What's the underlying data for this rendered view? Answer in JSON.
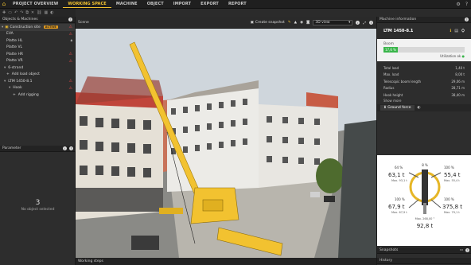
{
  "nav": {
    "items": [
      "PROJECT OVERVIEW",
      "WORKING SPACE",
      "MACHINE",
      "OBJECT",
      "IMPORT",
      "EXPORT",
      "REPORT"
    ],
    "active": "WORKING SPACE"
  },
  "left_panel": {
    "title": "Objects & Machines",
    "site": {
      "label": "Construction site",
      "badge": "ACTIVE"
    },
    "items": [
      {
        "label": "EVA",
        "flag": "warn"
      },
      {
        "label": "Platte HL",
        "flag": "lock"
      },
      {
        "label": "Platte VL",
        "flag": ""
      },
      {
        "label": "Platte HR",
        "flag": "warn"
      },
      {
        "label": "Platte VR",
        "flag": "warn"
      }
    ],
    "strand": "6-strand",
    "add_load": "Add load object",
    "machine": "LTM 1450-8.1",
    "hook": "Hook",
    "add_rigging": "Add rigging"
  },
  "parameter": {
    "title": "Parameter",
    "count": "3",
    "empty": "No object selected"
  },
  "scene": {
    "title": "Scene",
    "snapshot": "Create snapshot",
    "view": "3D view"
  },
  "working_steps": "Working steps",
  "machine_info": {
    "title": "Machine information",
    "machine": "LTM 1450-8.1",
    "boom_label": "Boom",
    "boom_value": "17,6 %",
    "boom_fraction": 0.176,
    "utilization": "Utilization ok",
    "stats": [
      {
        "label": "Total load",
        "value": "1,40 t"
      },
      {
        "label": "Max. load",
        "value": "8,00 t"
      },
      {
        "label": "Telescopic boom length",
        "value": "29,06 m"
      },
      {
        "label": "Radius",
        "value": "28,71 m"
      },
      {
        "label": "Hook height",
        "value": "38,40 m"
      }
    ],
    "show_more": "Show more",
    "ground_force": "Ground force",
    "forces": {
      "tl": {
        "pct": "64 %",
        "val": "63,1 t",
        "max": "Max. 93,1 t"
      },
      "tr": {
        "pct": "100 %",
        "val": "55,4 t",
        "max": "Max. 55,4 t"
      },
      "bl": {
        "pct": "100 %",
        "val": "67,9 t",
        "max": "Max. 67,9 t"
      },
      "br": {
        "pct": "100 %",
        "val": "375,8 t",
        "max": "Max. 79,1 t"
      },
      "center": {
        "max": "Max. 268,00 °",
        "val": "92,8 t"
      },
      "top_pct": "8 %"
    }
  },
  "snapshots": "Snapshots",
  "history": "History",
  "colors": {
    "accent": "#f2c230",
    "ok": "#39b54a",
    "warn": "#e04848",
    "active_badge": "#e39b1e"
  }
}
